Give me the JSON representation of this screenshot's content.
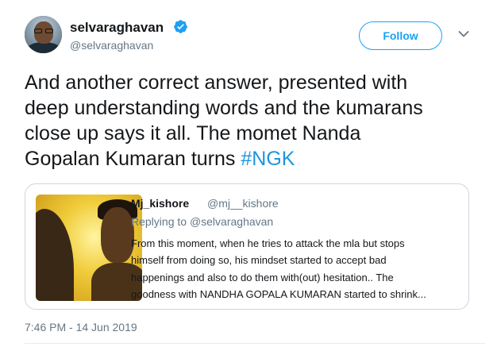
{
  "author": {
    "display_name": "selvaraghavan",
    "handle": "@selvaraghavan",
    "verified": true
  },
  "actions": {
    "follow_label": "Follow",
    "more_icon": "chevron-down-icon"
  },
  "tweet": {
    "text_lines": [
      "And another correct answer, presented with",
      "deep understanding words  and the kumarans",
      "close up says it all. The momet Nanda",
      "Gopalan Kumaran turns "
    ],
    "hashtag": "#NGK",
    "timestamp": "7:46 PM - 14 Jun 2019"
  },
  "quoted_tweet": {
    "display_name": "Mj_kishore",
    "handle": "@mj__kishore",
    "replying_prefix": "Replying to ",
    "replying_to": "@selvaraghavan",
    "body_lines": [
      "From this moment, when he tries to attack the mla but stops",
      "himself from doing so, his mindset started to accept bad",
      "happenings and also to do them with(out) hesitation.. The",
      "goodness with NANDHA GOPALA KUMARAN started to shrink..."
    ]
  },
  "colors": {
    "accent": "#1da1f2",
    "hashtag": "#1b95e0",
    "secondary_text": "#657786",
    "border": "#ccd6dd"
  }
}
